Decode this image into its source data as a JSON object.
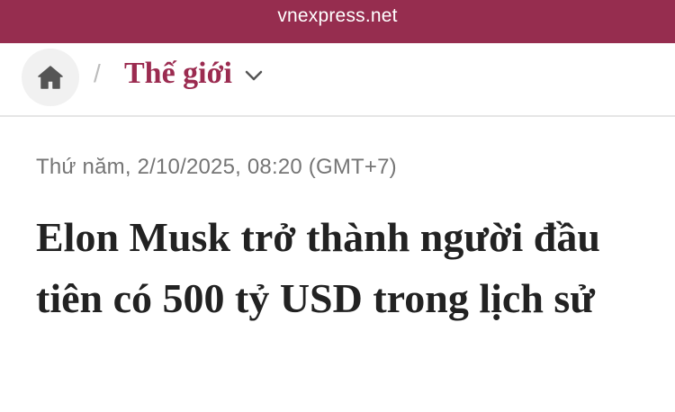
{
  "browser": {
    "url": "vnexpress.net"
  },
  "nav": {
    "home_icon": "home-icon",
    "separator": "/",
    "category": "Thế giới",
    "chevron_icon": "chevron-down-icon"
  },
  "article": {
    "date": "Thứ năm, 2/10/2025, 08:20 (GMT+7)",
    "title": "Elon Musk trở thành người đầu tiên có 500 tỷ USD trong lịch sử"
  },
  "colors": {
    "brand": "#962d4f",
    "category_text": "#9b2b50",
    "date_text": "#757575",
    "title_text": "#222222"
  }
}
